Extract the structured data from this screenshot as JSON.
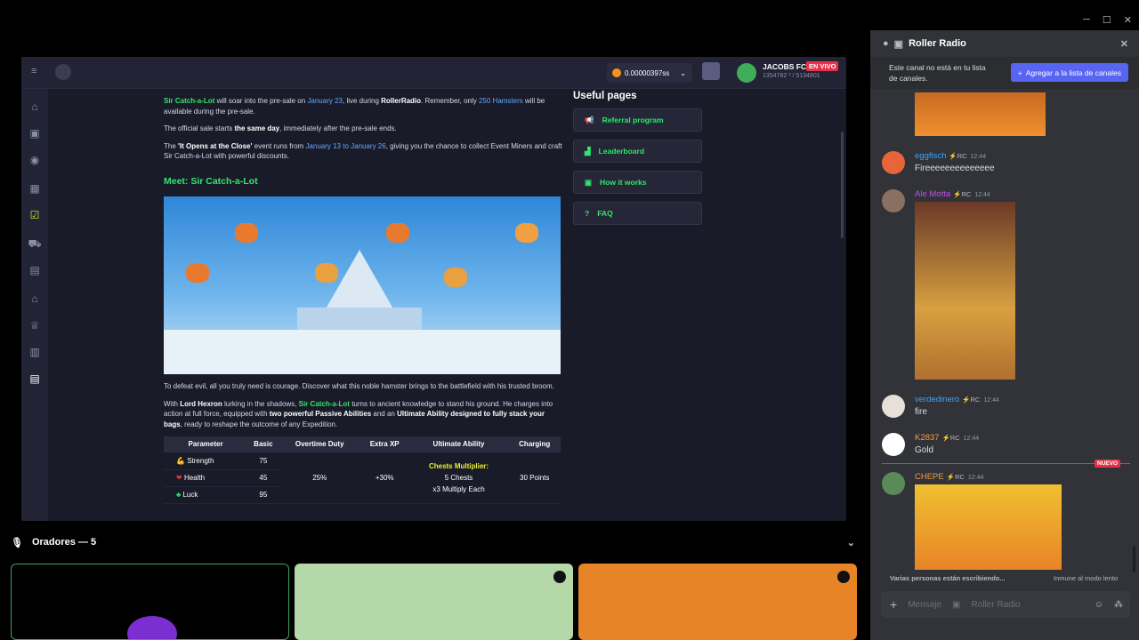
{
  "browser": {
    "wallet": "0.00000397ss",
    "user": "JACOBS FC",
    "live": "EN VIVO",
    "stats": "1354782 ³ / 5134801"
  },
  "article": {
    "p1": {
      "a": "Sir Catch-a-Lot",
      "b": " will soar into the pre-sale on ",
      "c": "January 23",
      "d": ", live during ",
      "e": "RollerRadio",
      "f": ". Remember, only ",
      "g": "250 Hamsters",
      "h": " will be available during the pre-sale."
    },
    "p2": {
      "a": "The official sale starts ",
      "b": "the same day",
      "c": ", immediately after the pre-sale ends."
    },
    "p3": {
      "a": "The ",
      "b": "'It Opens at the Close'",
      "c": " event runs from ",
      "d": "January 13 to January 26",
      "e": ", giving you the chance to collect Event Miners and craft Sir Catch-a-Lot with powerful discounts."
    },
    "meet": "Meet: Sir Catch-a-Lot",
    "p4": "To defeat evil, all you truly need is courage. Discover what this noble hamster brings to the battlefield with his trusted broom.",
    "p5": {
      "a": "With ",
      "b": "Lord Hexron",
      "c": " lurking in the shadows, ",
      "d": "Sir Catch-a-Lot",
      "e": " turns to ancient knowledge to stand his ground. He charges into action at full force, equipped with ",
      "f": "two powerful Passive Abilities",
      "g": " and an ",
      "h": "Ultimate Ability designed to fully stack your bags",
      "i": ", ready to reshape the outcome of any Expedition."
    },
    "table": {
      "headers": [
        "Parameter",
        "Basic",
        "Overtime Duty",
        "Extra XP",
        "Ultimate Ability",
        "Charging"
      ],
      "rows": [
        {
          "icon": "💪",
          "name": "Strength",
          "basic": "75"
        },
        {
          "icon": "❤",
          "name": "Health",
          "basic": "45"
        },
        {
          "icon": "♣",
          "name": "Luck",
          "basic": "95"
        }
      ],
      "overtime": "25%",
      "xp": "+30%",
      "ult_title": "Chests Multiplier:",
      "ult_l1": "5 Chests",
      "ult_l2": "x3 Multiply Each",
      "charging": "30 Points"
    }
  },
  "useful": {
    "title": "Useful pages",
    "items": [
      "Referral program",
      "Leaderboard",
      "How it works",
      "FAQ"
    ]
  },
  "speakers": {
    "label": "Oradores — 5"
  },
  "chat": {
    "channel": "Roller Radio",
    "notice": "Este canal no está en tu lista de canales.",
    "add_button": "Agregar a la lista de canales",
    "messages": [
      {
        "user": "eggfisch",
        "tag": "⚡RC",
        "time": "12:44",
        "text": "Fireeeeeeeeeeeeee",
        "color": "#3ba5ff"
      },
      {
        "user": "Ale Motta",
        "tag": "⚡RC",
        "time": "12:44",
        "text": "",
        "color": "#c050e8"
      },
      {
        "user": "verdedinero",
        "tag": "⚡RC",
        "time": "12:44",
        "text": "fire",
        "color": "#3ba5ff"
      },
      {
        "user": "K2837",
        "tag": "⚡RC",
        "time": "12:44",
        "text": "Gold",
        "color": "#f0a040"
      },
      {
        "user": "CHEPE",
        "tag": "⚡RC",
        "time": "12:44",
        "text": "",
        "color": "#f0a040"
      }
    ],
    "new_badge": "NUEVO",
    "typing": "Varias personas están escribiendo...",
    "slowmode": "Inmune al modo lento",
    "composer_placeholder": "Mensaje",
    "composer_channel": "Roller Radio"
  }
}
